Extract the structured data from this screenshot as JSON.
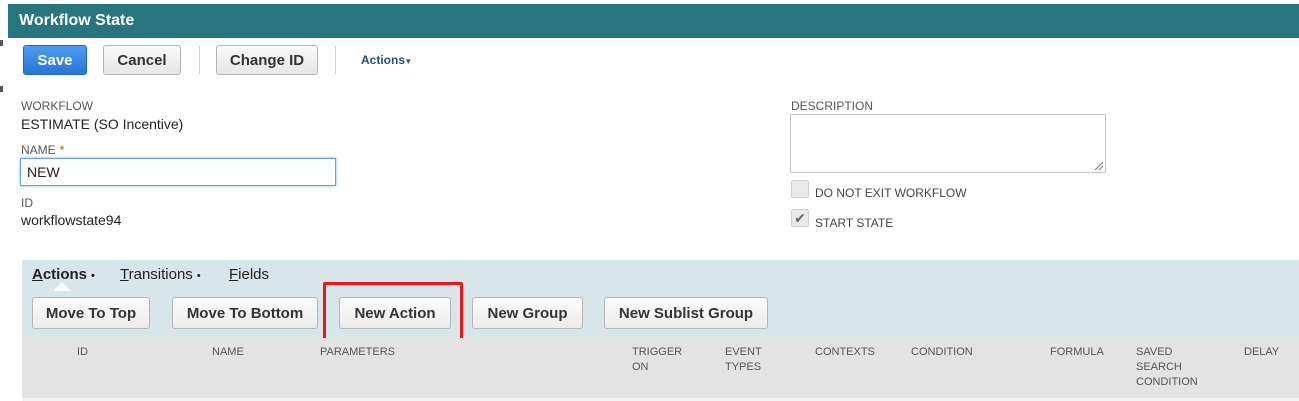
{
  "title": "Workflow State",
  "toolbar": {
    "save": "Save",
    "cancel": "Cancel",
    "change_id": "Change ID",
    "actions": "Actions",
    "actions_caret": "▾"
  },
  "fields": {
    "workflow_label": "WORKFLOW",
    "workflow_value": "ESTIMATE (SO Incentive)",
    "name_label": "NAME",
    "required_mark": "*",
    "name_value": "NEW",
    "id_label": "ID",
    "id_value": "workflowstate94",
    "description_label": "DESCRIPTION",
    "description_value": "",
    "do_not_exit_label": "DO NOT EXIT WORKFLOW",
    "do_not_exit_checked": false,
    "start_state_label": "START STATE",
    "start_state_checked": true,
    "check_glyph": "✔"
  },
  "subtabs": {
    "items": [
      {
        "letter": "A",
        "rest": "ctions",
        "dot": "•",
        "active": true
      },
      {
        "letter": "T",
        "rest": "ransitions",
        "dot": "•",
        "active": false
      },
      {
        "letter": "F",
        "rest": "ields",
        "dot": "",
        "active": false
      }
    ]
  },
  "sublist_buttons": {
    "move_to_top": "Move To Top",
    "move_to_bottom": "Move To Bottom",
    "new_action": "New Action",
    "new_group": "New Group",
    "new_sublist_group": "New Sublist Group"
  },
  "columns": {
    "id": "ID",
    "name": "NAME",
    "parameters": "PARAMETERS",
    "trigger_on_1": "TRIGGER",
    "trigger_on_2": "ON",
    "event_types_1": "EVENT",
    "event_types_2": "TYPES",
    "contexts": "CONTEXTS",
    "condition": "CONDITION",
    "formula": "FORMULA",
    "saved_1": "SAVED",
    "saved_2": "SEARCH",
    "saved_3": "CONDITION",
    "delay": "DELAY"
  },
  "colors": {
    "title_bar": "#27757f",
    "primary_button": "#2576d9",
    "highlight_box": "#ef1414",
    "subtab_panel": "#d8e5ea"
  }
}
